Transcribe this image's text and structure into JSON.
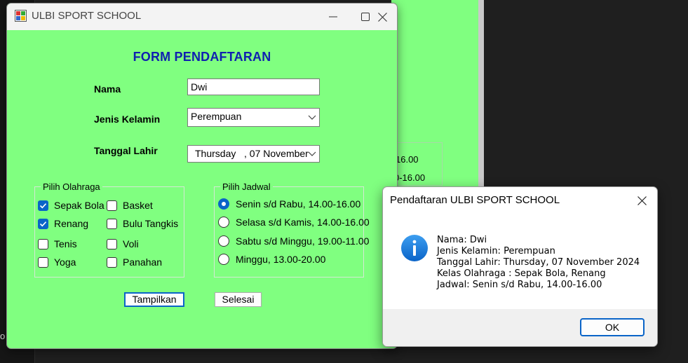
{
  "background": {
    "fragments": [
      "0",
      "16.00",
      "0-16.00",
      "o"
    ]
  },
  "main_window": {
    "title": "ULBI SPORT SCHOOL",
    "form_title": "FORM PENDAFTARAN",
    "labels": {
      "nama": "Nama",
      "jenis_kelamin": "Jenis Kelamin",
      "tanggal_lahir": "Tanggal Lahir"
    },
    "nama_value": "Dwi",
    "jenis_kelamin_value": "Perempuan",
    "tanggal_lahir_value": "Thursday   , 07 November",
    "olahraga_group": {
      "caption": "Pilih Olahraga",
      "items": [
        {
          "label": "Sepak Bola",
          "checked": true
        },
        {
          "label": "Basket",
          "checked": false
        },
        {
          "label": "Renang",
          "checked": true
        },
        {
          "label": "Bulu Tangkis",
          "checked": false
        },
        {
          "label": "Tenis",
          "checked": false
        },
        {
          "label": "Voli",
          "checked": false
        },
        {
          "label": "Yoga",
          "checked": false
        },
        {
          "label": "Panahan",
          "checked": false
        }
      ]
    },
    "jadwal_group": {
      "caption": "Pilih Jadwal",
      "items": [
        {
          "label": "Senin s/d Rabu, 14.00-16.00",
          "checked": true
        },
        {
          "label": "Selasa s/d Kamis, 14.00-16.00",
          "checked": false
        },
        {
          "label": "Sabtu s/d Minggu, 19.00-11.00",
          "checked": false
        },
        {
          "label": "Minggu, 13.00-20.00",
          "checked": false
        }
      ]
    },
    "buttons": {
      "tampilkan": "Tampilkan",
      "selesai": "Selesai"
    }
  },
  "message_box": {
    "title": "Pendaftaran ULBI SPORT SCHOOL",
    "lines": [
      "Nama: Dwi",
      "Jenis Kelamin: Perempuan",
      "Tanggal Lahir: Thursday, 07 November 2024",
      "Kelas Olahraga : Sepak Bola, Renang",
      "Jadwal: Senin s/d Rabu, 14.00-16.00"
    ],
    "ok_label": "OK"
  },
  "colors": {
    "form_background": "#80ff80",
    "title_text": "#1020b0",
    "accent": "#0a64c8"
  }
}
